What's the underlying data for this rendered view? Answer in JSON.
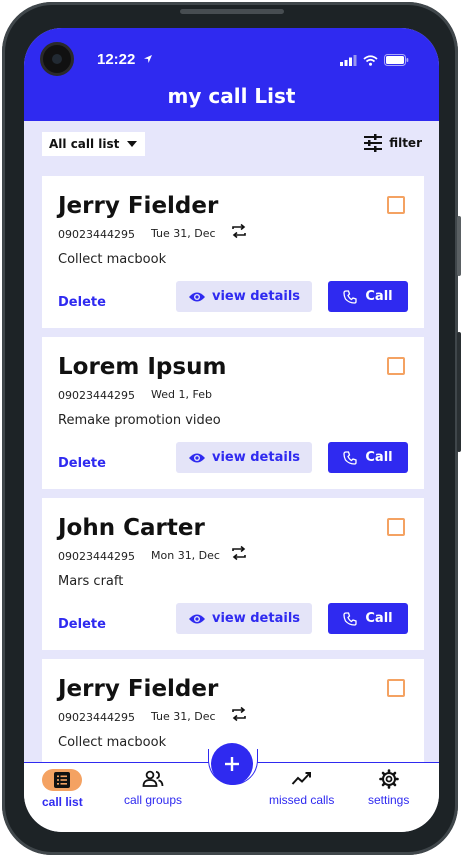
{
  "status_bar": {
    "time": "12:22"
  },
  "header": {
    "title": "my call List"
  },
  "toolbar": {
    "select_value": "All call list",
    "filter_label": "filter"
  },
  "cards": [
    {
      "name": "Jerry Fielder",
      "phone": "09023444295",
      "date": "Tue 31, Dec",
      "repeat": true,
      "task": "Collect macbook",
      "delete_label": "Delete",
      "view_label": "view details",
      "call_label": "Call"
    },
    {
      "name": "Lorem Ipsum",
      "phone": "09023444295",
      "date": "Wed 1, Feb",
      "repeat": false,
      "task": "Remake promotion video",
      "delete_label": "Delete",
      "view_label": "view details",
      "call_label": "Call"
    },
    {
      "name": "John Carter",
      "phone": "09023444295",
      "date": "Mon 31, Dec",
      "repeat": true,
      "task": "Mars craft",
      "delete_label": "Delete",
      "view_label": "view details",
      "call_label": "Call"
    },
    {
      "name": "Jerry Fielder",
      "phone": "09023444295",
      "date": "Tue 31, Dec",
      "repeat": true,
      "task": "Collect macbook",
      "delete_label": "Delete",
      "view_label": "view details",
      "call_label": "Call"
    }
  ],
  "bottom_nav": {
    "items": [
      {
        "label": "call list",
        "icon": "list-icon",
        "active": true
      },
      {
        "label": "call groups",
        "icon": "people-icon",
        "active": false
      },
      {
        "label": "missed calls",
        "icon": "trend-icon",
        "active": false
      },
      {
        "label": "settings",
        "icon": "gear-icon",
        "active": false
      }
    ],
    "fab_icon": "plus-icon"
  },
  "colors": {
    "primary": "#2f2af0",
    "accent": "#f4a262",
    "background": "#e6e6fb"
  }
}
